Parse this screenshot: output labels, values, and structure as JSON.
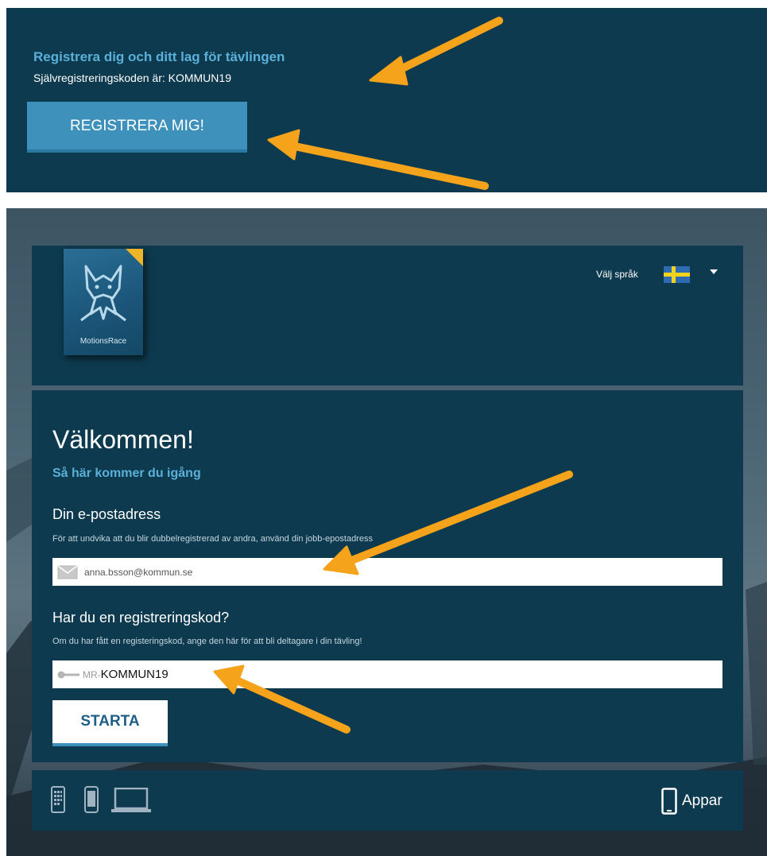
{
  "top": {
    "title": "Registrera dig och ditt lag för tävlingen",
    "code_text": "Självregistreringskoden är: KOMMUN19",
    "register_button": "REGISTRERA MIG!"
  },
  "header": {
    "logo_text": "MotionsRace",
    "language_label": "Välj språk",
    "language_flag": "swedish-flag"
  },
  "main": {
    "welcome": "Välkommen!",
    "howto_link": "Så här kommer du igång",
    "email": {
      "label": "Din e-postadress",
      "hint": "För att undvika att du blir dubbelregistrerad av andra, använd din jobb-epostadress",
      "value": "anna.bsson@kommun.se"
    },
    "code": {
      "label": "Har du en registreringskod?",
      "hint": "Om du har fått en registeringskod, ange den här för att bli deltagare i din tävling!",
      "prefix": "MR-",
      "value": "KOMMUN19"
    },
    "start_button": "STARTA"
  },
  "footer": {
    "apps_label": "Appar",
    "icons": [
      "tablet-icon",
      "phone-icon",
      "laptop-icon"
    ]
  },
  "colors": {
    "panel": "#0d3a4e",
    "accent": "#3e91ba",
    "link": "#5ab0d8",
    "arrow": "#f5a31a"
  }
}
